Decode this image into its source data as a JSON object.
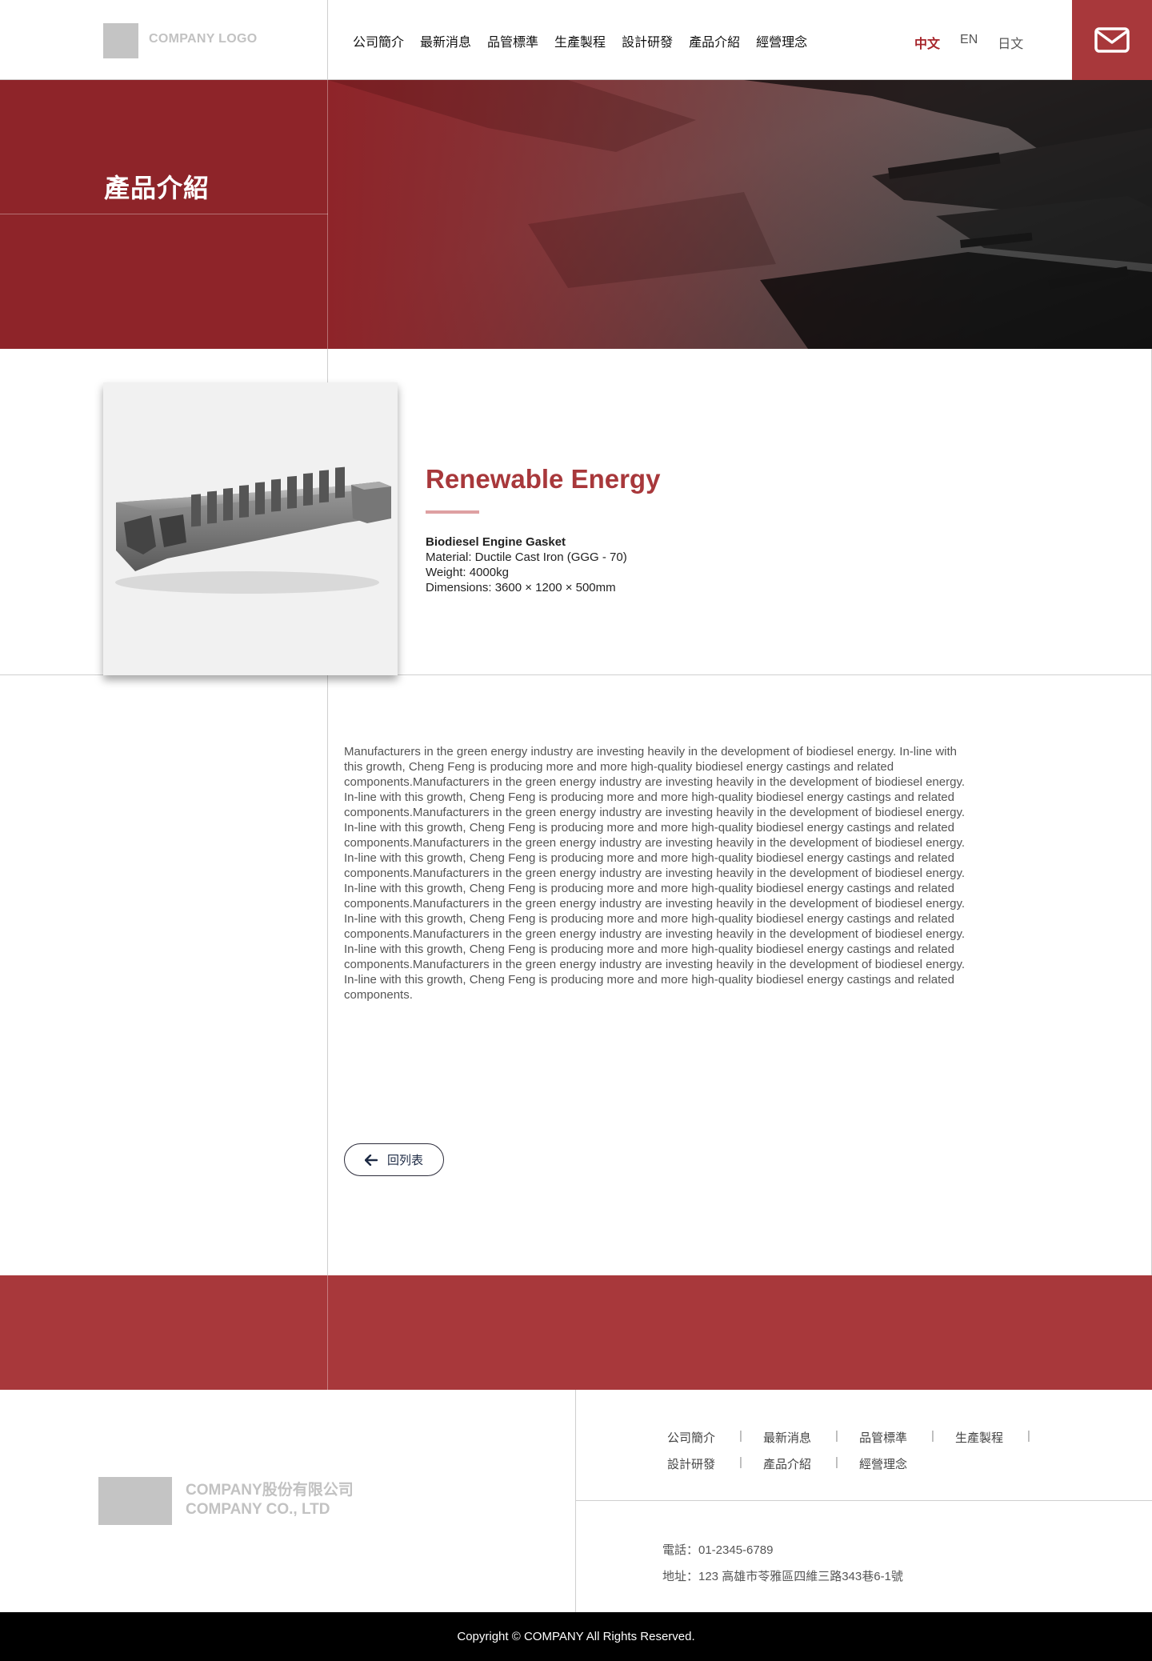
{
  "header": {
    "logo_text": "COMPANY LOGO",
    "nav": [
      "公司簡介",
      "最新消息",
      "品管標準",
      "生產製程",
      "設計研發",
      "產品介紹",
      "經營理念"
    ],
    "languages": [
      "中文",
      "EN",
      "日文"
    ],
    "active_language": "中文",
    "mail_icon": "envelope-icon"
  },
  "banner": {
    "title": "產品介紹"
  },
  "product": {
    "category": "Renewable Energy",
    "name": "Biodiesel Engine Gasket",
    "material": "Material: Ductile Cast Iron (GGG - 70)",
    "weight": "Weight: 4000kg",
    "dimensions": "Dimensions: 3600 × 1200 × 500mm",
    "description": "Manufacturers in the green energy industry are investing heavily in the development of biodiesel energy. In-line with this growth, Cheng Feng is producing more and more high-quality biodiesel energy castings and related components.Manufacturers in the green energy industry are investing heavily in the development of biodiesel energy. In-line with this growth, Cheng Feng is producing more and more high-quality biodiesel energy castings and related components.Manufacturers in the green energy industry are investing heavily in the development of biodiesel energy. In-line with this growth, Cheng Feng is producing more and more high-quality biodiesel energy castings and related components.Manufacturers in the green energy industry are investing heavily in the development of biodiesel energy. In-line with this growth, Cheng Feng is producing more and more high-quality biodiesel energy castings and related components.Manufacturers in the green energy industry are investing heavily in the development of biodiesel energy. In-line with this growth, Cheng Feng is producing more and more high-quality biodiesel energy castings and related components.Manufacturers in the green energy industry are investing heavily in the development of biodiesel energy. In-line with this growth, Cheng Feng is producing more and more high-quality biodiesel energy castings and related components.Manufacturers in the green energy industry are investing heavily in the development of biodiesel energy. In-line with this growth, Cheng Feng is producing more and more high-quality biodiesel energy castings and related components.Manufacturers in the green energy industry are investing heavily in the development of biodiesel energy. In-line with this growth, Cheng Feng is producing more and more high-quality biodiesel energy castings and related components.",
    "back_label": "回列表"
  },
  "footer": {
    "company_zh": "COMPANY股份有限公司",
    "company_en": "COMPANY CO., LTD",
    "links_row1": [
      "公司簡介",
      "最新消息",
      "品管標準",
      "生產製程"
    ],
    "links_row2": [
      "設計研發",
      "產品介紹",
      "經營理念"
    ],
    "phone": "電話：01-2345-6789",
    "address": "地址：123 高雄市苓雅區四維三路343巷6-1號",
    "copyright": "Copyright © COMPANY All Rights Reserved."
  },
  "colors": {
    "brand_red": "#a8383b",
    "banner_red": "#8e2429",
    "active_lang": "#a6252b"
  }
}
